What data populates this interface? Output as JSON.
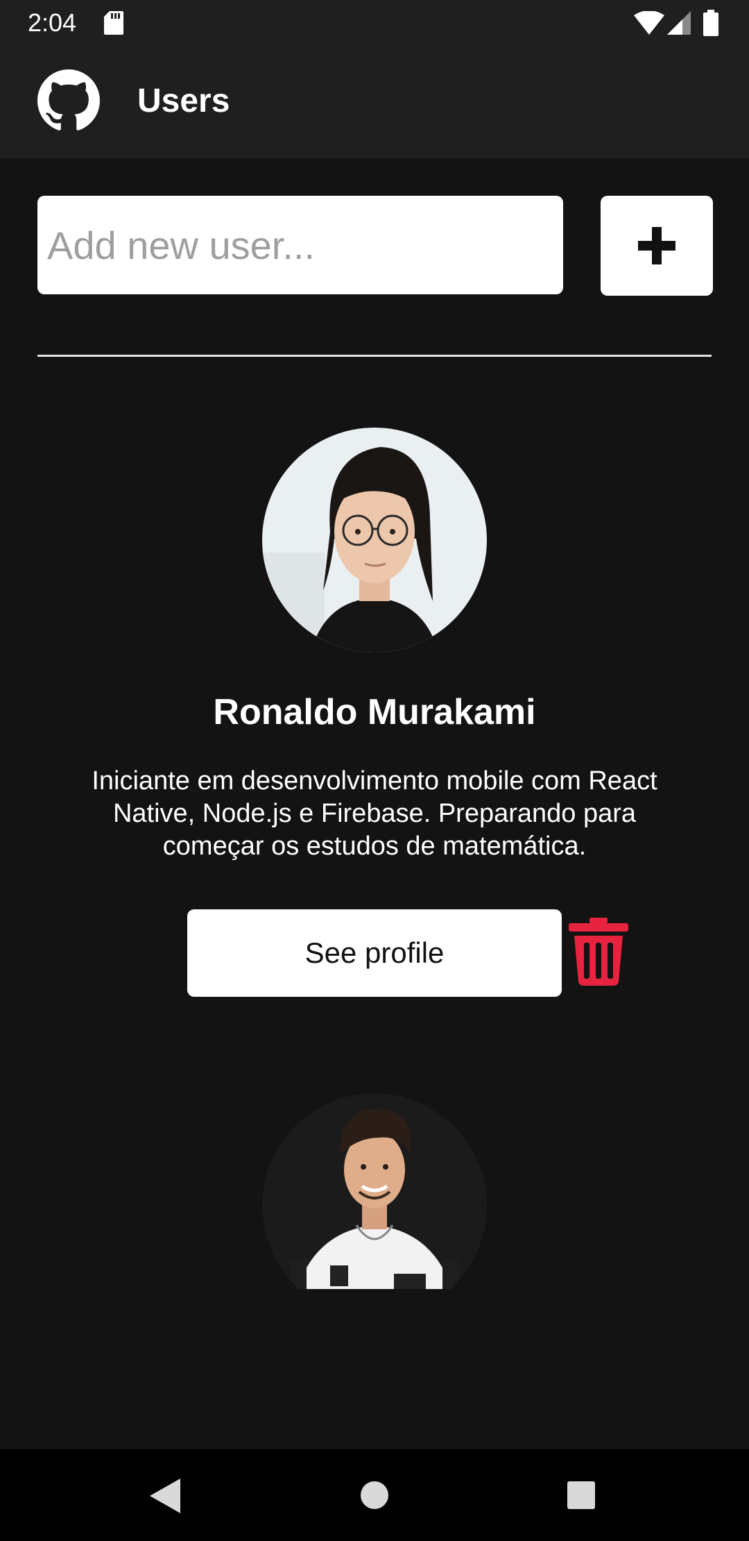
{
  "status_bar": {
    "time": "2:04",
    "icons": [
      "sd-card-icon",
      "wifi-icon",
      "signal-icon",
      "battery-icon"
    ]
  },
  "app_bar": {
    "logo_icon": "github-icon",
    "title": "Users"
  },
  "add_user": {
    "placeholder": "Add new user...",
    "value": "",
    "add_icon": "plus-icon"
  },
  "users": [
    {
      "name": "Ronaldo Murakami",
      "bio": "Iniciante em desenvolvimento mobile com React Native, Node.js e Firebase. Preparando para começar os estudos de matemática.",
      "profile_button_label": "See profile",
      "delete_icon": "trash-icon"
    }
  ],
  "navigation": {
    "icons": [
      "back-icon",
      "home-icon",
      "recent-apps-icon"
    ]
  },
  "colors": {
    "background": "#131313",
    "bar": "#1f1f1f",
    "surface": "#ffffff",
    "delete": "#e8233f",
    "nav_bar": "#000000"
  }
}
